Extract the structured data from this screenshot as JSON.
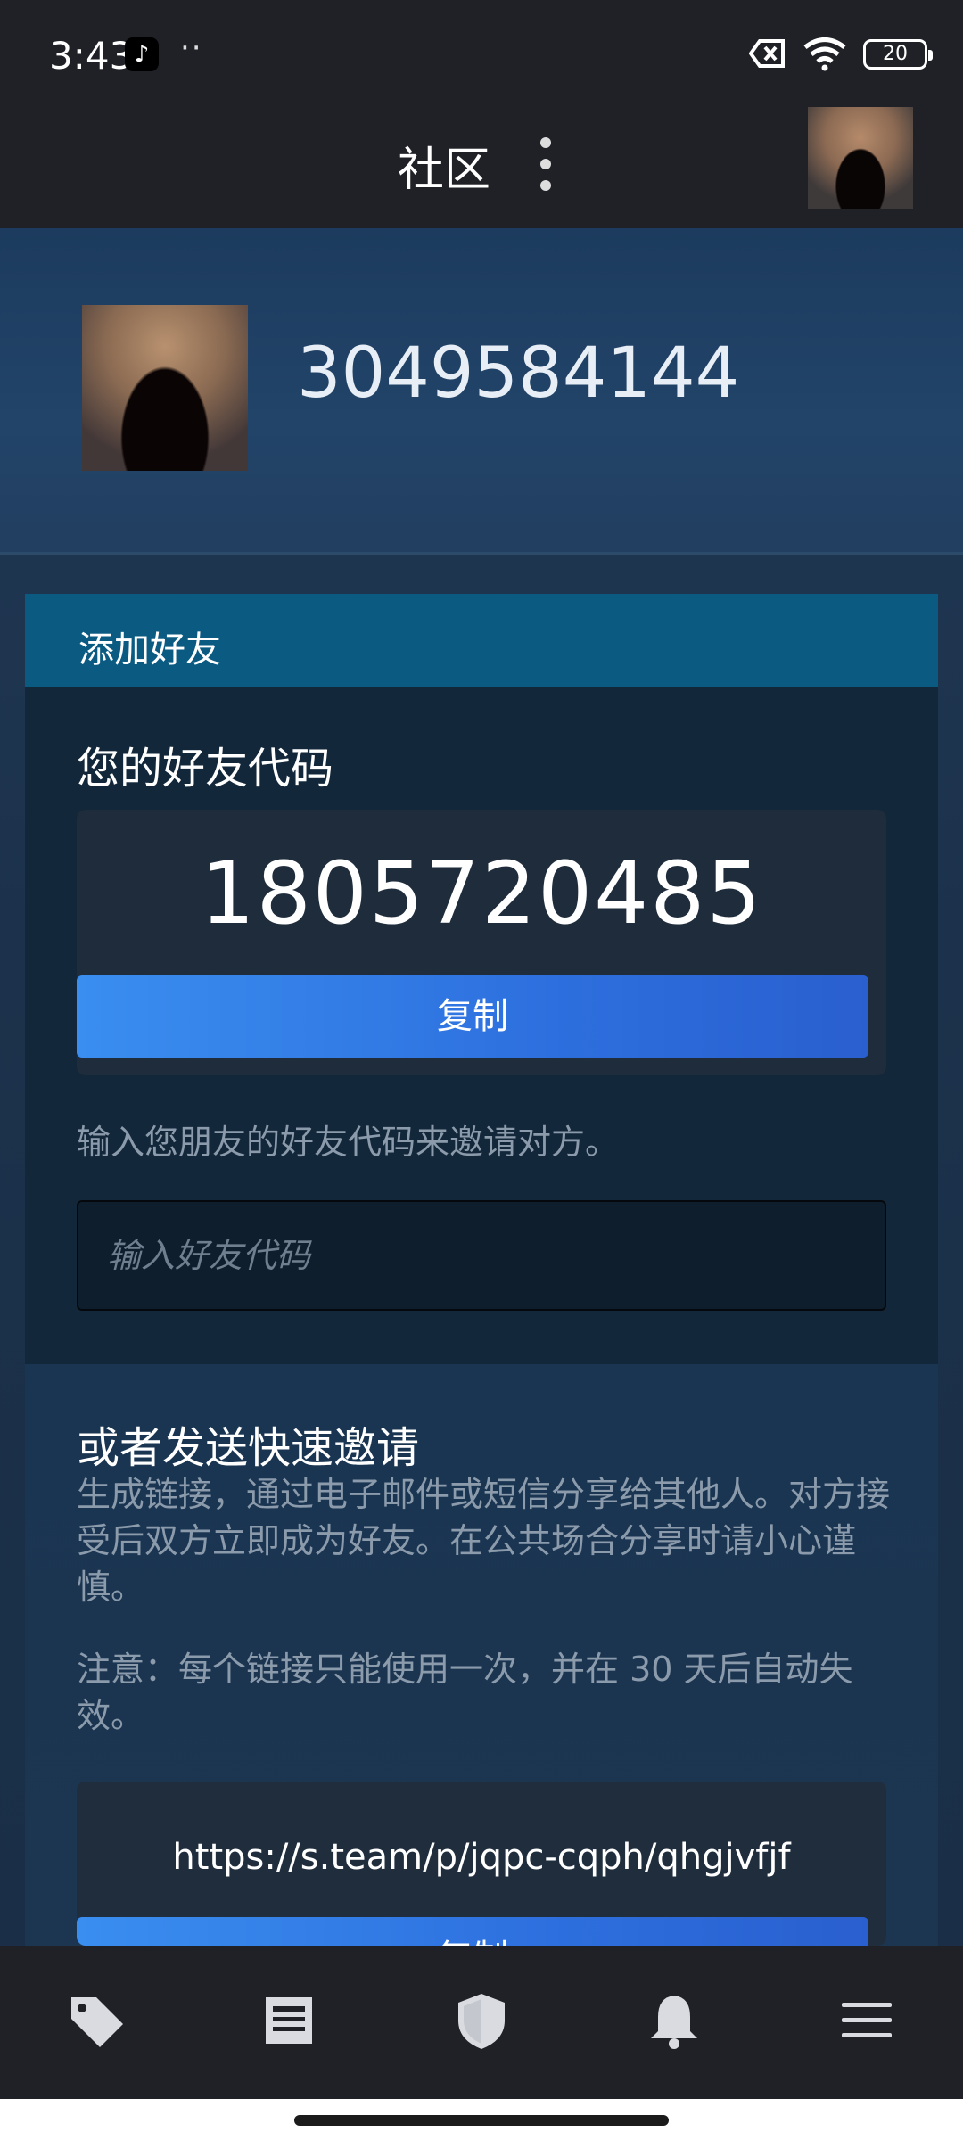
{
  "status_bar": {
    "time": "3:43",
    "dots": "··",
    "battery": "20",
    "icons": [
      "tiktok-icon",
      "no-sim-icon",
      "wifi-icon",
      "battery-icon"
    ]
  },
  "header": {
    "title": "社区",
    "menu_icon": "more-vertical-icon"
  },
  "profile": {
    "name": "3049584144"
  },
  "add_friend": {
    "header": "添加好友",
    "code_title": "您的好友代码",
    "friend_code": "1805720485",
    "copy_label": "复制",
    "invite_hint": "输入您朋友的好友代码来邀请对方。",
    "input_placeholder": "输入好友代码",
    "input_value": ""
  },
  "quick_invite": {
    "title": "或者发送快速邀请",
    "description": "生成链接，通过电子邮件或短信分享给其他人。对方接受后双方立即成为好友。在公共场合分享时请小心谨慎。",
    "note": "注意：每个链接只能使用一次，并在 30 天后自动失效。",
    "link": "https://s.team/p/jqpc-cqph/qhgjvfjf",
    "copy_label": "复制"
  },
  "bottom_nav": {
    "items": [
      "store-tag-icon",
      "news-icon",
      "shield-icon",
      "notifications-bell-icon",
      "hamburger-menu-icon"
    ]
  },
  "colors": {
    "header_bg": "#1f2126",
    "profile_bg": "#1c3b5e",
    "card_header": "#0a5a82",
    "button_start": "#3a8ef0",
    "button_end": "#2a5fcf",
    "muted_text": "#8b9bab"
  }
}
